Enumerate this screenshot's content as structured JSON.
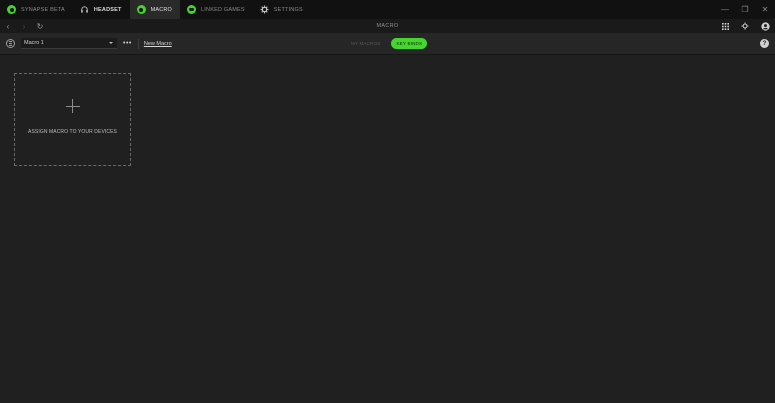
{
  "titlebar": {
    "tabs": [
      {
        "label": "SYNAPSE BETA",
        "icon": "razer-logo-icon",
        "active": false
      },
      {
        "label": "HEADSET",
        "icon": "headset-icon",
        "active": false
      },
      {
        "label": "MACRO",
        "icon": "macro-icon",
        "active": true
      },
      {
        "label": "LINKED GAMES",
        "icon": "gamepad-icon",
        "active": false
      },
      {
        "label": "SETTINGS",
        "icon": "gear-icon",
        "active": false
      }
    ],
    "window_controls": {
      "minimize": "—",
      "maximize": "❐",
      "close": "✕"
    }
  },
  "navbar": {
    "back": "‹",
    "forward": "›",
    "refresh": "↻",
    "title": "MACRO"
  },
  "toolbar": {
    "macro_select": "Macro 1",
    "more": "•••",
    "new_macro": "New Macro",
    "segments": [
      "MY MACROS",
      "KEY BINDS"
    ],
    "active_segment": "KEY BINDS",
    "help": "?"
  },
  "card": {
    "label": "ASSIGN MACRO TO YOUR DEVICES"
  },
  "colors": {
    "accent": "#44d62c",
    "background": "#202020",
    "titlebar": "#111111"
  }
}
